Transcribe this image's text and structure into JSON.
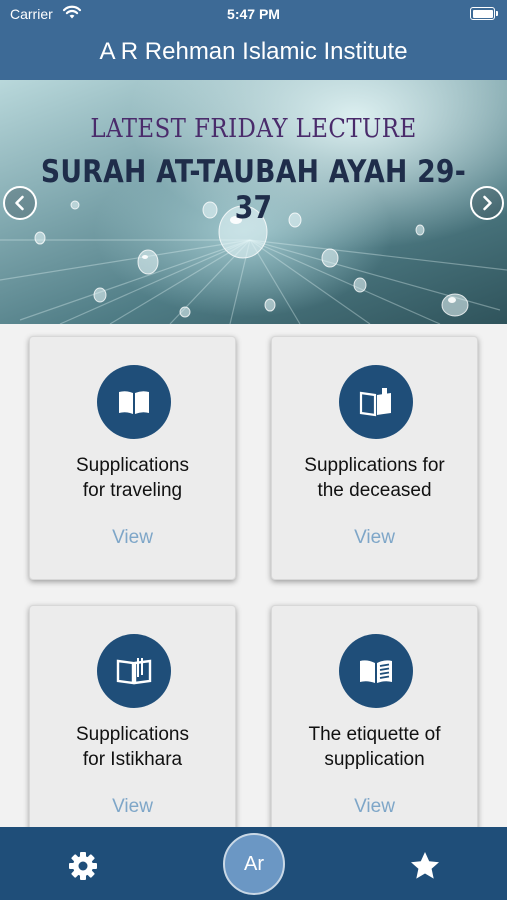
{
  "status_bar": {
    "carrier": "Carrier",
    "time": "5:47 PM",
    "wifi_icon": "wifi-icon",
    "battery_icon": "battery-icon"
  },
  "nav": {
    "title": "A R Rehman Islamic Institute"
  },
  "banner": {
    "subtitle": "LATEST FRIDAY LECTURE",
    "title": "SURAH  AT-TAUBAH AYAH 29-37",
    "prev_icon": "chevron-left-icon",
    "next_icon": "chevron-right-icon",
    "slide_count": 3,
    "active_slide": 1
  },
  "cards": [
    {
      "title_line1": "Supplications",
      "title_line2": "for traveling",
      "action": "View",
      "icon": "book-open-icon"
    },
    {
      "title_line1": "Supplications for",
      "title_line2": "the deceased",
      "action": "View",
      "icon": "book-bookmark-icon"
    },
    {
      "title_line1": "Supplications",
      "title_line2": "for Istikhara",
      "action": "View",
      "icon": "book-outline-icon"
    },
    {
      "title_line1": "The etiquette of",
      "title_line2": "supplication",
      "action": "View",
      "icon": "book-text-icon"
    }
  ],
  "tab_bar": {
    "settings_icon": "gear-icon",
    "language_label": "Ar",
    "favorites_icon": "star-icon"
  },
  "colors": {
    "header": "#3d6a96",
    "tab_bar": "#1f4e79",
    "icon_circle": "#1f4e79",
    "view_link": "#7ea6c8",
    "language_button": "#6b97c4"
  }
}
